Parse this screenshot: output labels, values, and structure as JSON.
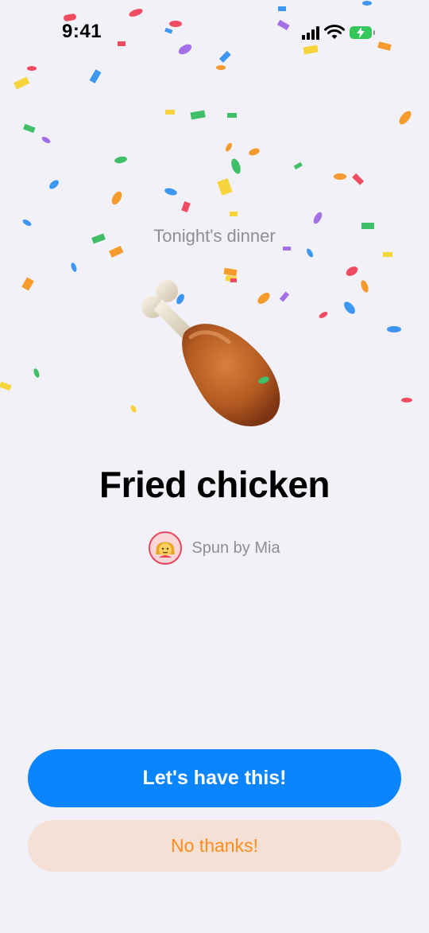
{
  "status_bar": {
    "time": "9:41",
    "battery_color": "#34c759"
  },
  "header": {
    "subtitle": "Tonight's dinner"
  },
  "result": {
    "food_icon": "fried-chicken-drumstick",
    "food_name": "Fried chicken",
    "spinner_avatar_icon": "person-emoji",
    "spun_by": "Spun by Mia"
  },
  "actions": {
    "accept_label": "Let's have this!",
    "decline_label": "No thanks!"
  },
  "colors": {
    "accent": "#0a84ff",
    "secondary_text": "#ff8c1a",
    "secondary_bg": "#f4e0d5",
    "background": "#f2f1f7"
  }
}
